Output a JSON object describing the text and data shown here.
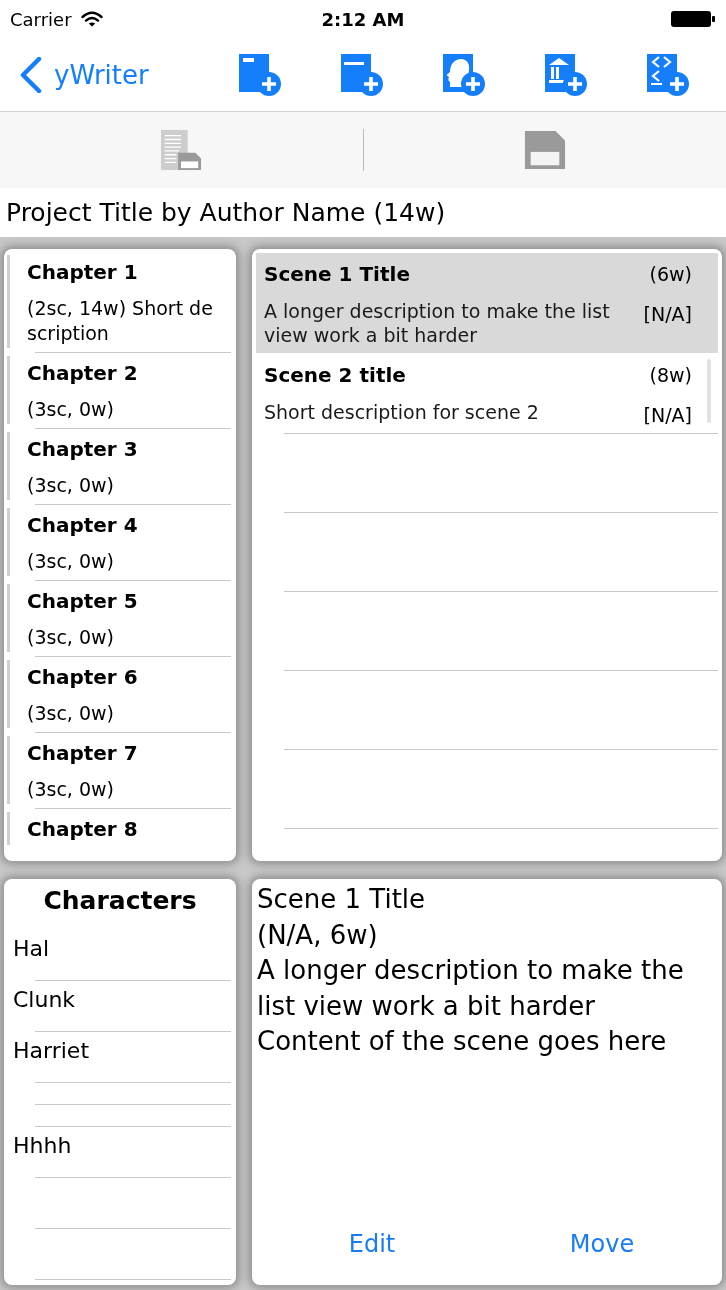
{
  "status_bar": {
    "carrier": "Carrier",
    "time": "2:12 AM"
  },
  "nav": {
    "back": "yWriter",
    "actions": [
      {
        "kind": "block"
      },
      {
        "kind": "line"
      },
      {
        "kind": "person"
      },
      {
        "kind": "building"
      },
      {
        "kind": "brackets"
      }
    ]
  },
  "toolbar": {
    "buttons": [
      {
        "kind": "export",
        "disabled": true
      },
      {
        "kind": "save",
        "disabled": true
      }
    ]
  },
  "project_title": "Project Title by Author Name (14w)",
  "chapters": [
    {
      "title": "Chapter 1",
      "summary": "(2sc, 14w) Short description",
      "selected": false
    },
    {
      "title": "Chapter 2",
      "summary": "(3sc, 0w)",
      "selected": false
    },
    {
      "title": "Chapter 3",
      "summary": "(3sc, 0w)",
      "selected": false
    },
    {
      "title": "Chapter 4",
      "summary": "(3sc, 0w)",
      "selected": false
    },
    {
      "title": "Chapter 5",
      "summary": "(3sc, 0w)",
      "selected": false
    },
    {
      "title": "Chapter 6",
      "summary": "(3sc, 0w)",
      "selected": false
    },
    {
      "title": "Chapter 7",
      "summary": "(3sc, 0w)",
      "selected": false
    },
    {
      "title": "Chapter 8",
      "selected": false
    }
  ],
  "scenes": [
    {
      "title": "Scene 1 Title",
      "words": "(6w)",
      "summary": "A longer description to make the list view work a bit harder",
      "status": "[N/A]",
      "selected": true
    },
    {
      "title": "Scene 2 title",
      "words": "(8w)",
      "summary": "Short description for scene 2",
      "status": "[N/A]",
      "selected": false
    }
  ],
  "characters": {
    "title": "Characters",
    "items": [
      {
        "kind": "name",
        "name": "Hal"
      },
      {
        "kind": "name",
        "name": "Clunk"
      },
      {
        "kind": "name",
        "name": "Harriet"
      },
      {
        "kind": "blank"
      },
      {
        "kind": "blank"
      },
      {
        "kind": "name",
        "name": "Hhhh"
      }
    ]
  },
  "detail": {
    "title": "Scene 1 Title",
    "meta": "(N/A, 6w)",
    "summary": "A longer description to make the list view work a bit harder",
    "content": "Content of the scene goes here",
    "buttons": [
      "Edit",
      "Move"
    ]
  }
}
